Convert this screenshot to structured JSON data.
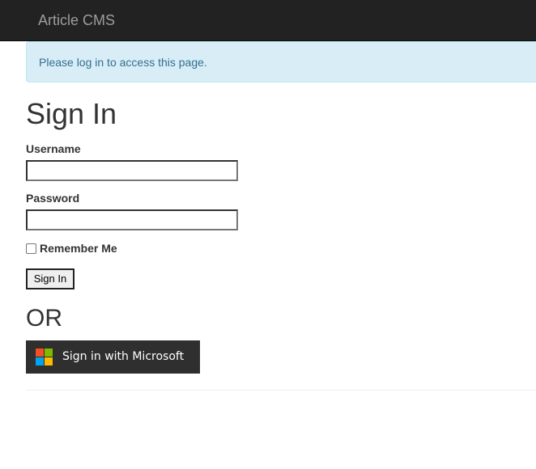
{
  "navbar": {
    "brand": "Article CMS"
  },
  "alert": {
    "message": "Please log in to access this page."
  },
  "form": {
    "title": "Sign In",
    "username_label": "Username",
    "username_value": "",
    "password_label": "Password",
    "password_value": "",
    "remember_label": "Remember Me",
    "remember_checked": false,
    "submit_label": "Sign In"
  },
  "alt": {
    "or_label": "OR",
    "microsoft_label": "Sign in with Microsoft",
    "microsoft_logo_colors": [
      "#f25022",
      "#7fba00",
      "#00a4ef",
      "#ffb900"
    ]
  },
  "colors": {
    "navbar_bg": "#222222",
    "brand_text": "#9d9d9d",
    "alert_bg": "#d9edf7",
    "alert_text": "#31708f",
    "ms_button_bg": "#2f2f2f"
  }
}
